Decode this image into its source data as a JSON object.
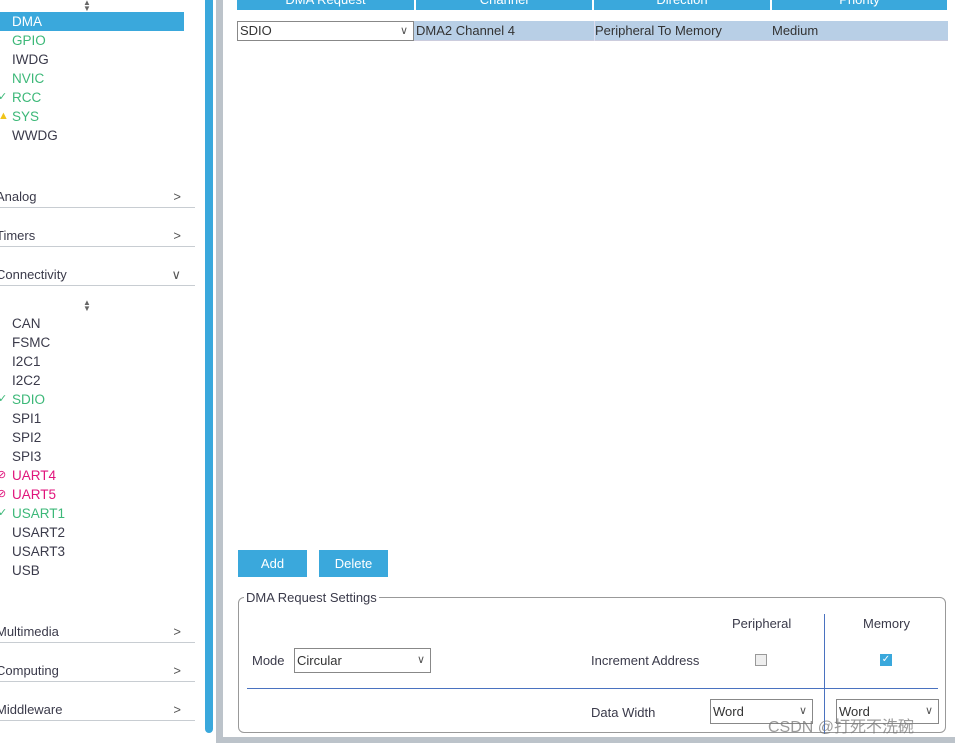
{
  "sidebar": {
    "system_items": [
      {
        "label": "DMA",
        "state": "selected"
      },
      {
        "label": "GPIO",
        "state": "green"
      },
      {
        "label": "IWDG",
        "state": "normal"
      },
      {
        "label": "NVIC",
        "state": "green"
      },
      {
        "label": "RCC",
        "state": "ok"
      },
      {
        "label": "SYS",
        "state": "warning"
      },
      {
        "label": "WWDG",
        "state": "normal"
      }
    ],
    "categories": {
      "analog": "Analog",
      "timers": "Timers",
      "connectivity": "Connectivity",
      "multimedia": "Multimedia",
      "computing": "Computing",
      "middleware": "Middleware"
    },
    "connectivity_items": [
      {
        "label": "CAN",
        "state": "normal"
      },
      {
        "label": "FSMC",
        "state": "normal"
      },
      {
        "label": "I2C1",
        "state": "normal"
      },
      {
        "label": "I2C2",
        "state": "normal"
      },
      {
        "label": "SDIO",
        "state": "ok"
      },
      {
        "label": "SPI1",
        "state": "normal"
      },
      {
        "label": "SPI2",
        "state": "normal"
      },
      {
        "label": "SPI3",
        "state": "normal"
      },
      {
        "label": "UART4",
        "state": "disabled"
      },
      {
        "label": "UART5",
        "state": "disabled"
      },
      {
        "label": "USART1",
        "state": "ok"
      },
      {
        "label": "USART2",
        "state": "normal"
      },
      {
        "label": "USART3",
        "state": "normal"
      },
      {
        "label": "USB",
        "state": "normal"
      }
    ]
  },
  "table": {
    "headers": [
      "DMA Request",
      "Channel",
      "Direction",
      "Priority"
    ],
    "rows": [
      {
        "request": "SDIO",
        "channel": "DMA2 Channel 4",
        "direction": "Peripheral To Memory",
        "priority": "Medium"
      }
    ]
  },
  "buttons": {
    "add": "Add",
    "delete": "Delete"
  },
  "settings": {
    "title": "DMA Request Settings",
    "mode_label": "Mode",
    "mode_value": "Circular",
    "peripheral_label": "Peripheral",
    "memory_label": "Memory",
    "increment_label": "Increment Address",
    "peripheral_increment": false,
    "memory_increment": true,
    "data_width_label": "Data Width",
    "peripheral_width": "Word",
    "memory_width": "Word"
  },
  "watermark": "CSDN @打死不洗碗",
  "colors": {
    "accent": "#3aa8dc",
    "ok": "#3cb878",
    "disabled": "#e0147c",
    "warning": "#f0c419"
  }
}
